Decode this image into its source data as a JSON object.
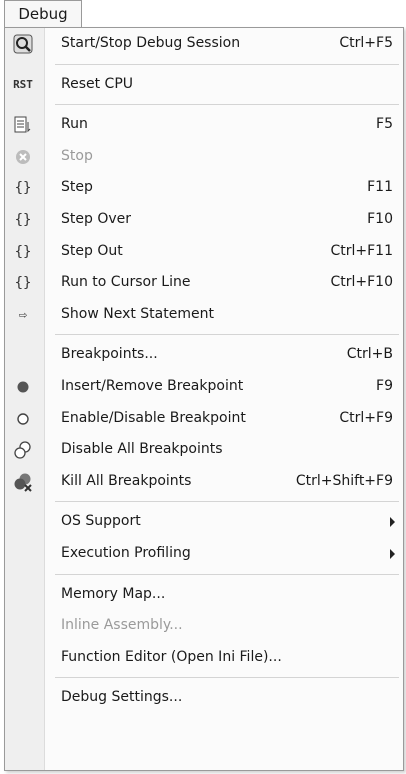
{
  "menu_title": "Debug",
  "items": {
    "start_stop": {
      "label": "Start/Stop Debug Session",
      "shortcut": "Ctrl+F5",
      "icon": "debug-session-icon"
    },
    "reset_cpu": {
      "label": "Reset CPU",
      "shortcut": "",
      "icon": "reset-cpu-icon",
      "icon_text": "RST"
    },
    "run": {
      "label": "Run",
      "shortcut": "F5",
      "icon": "run-icon"
    },
    "stop": {
      "label": "Stop",
      "shortcut": "",
      "icon": "stop-icon",
      "disabled": true
    },
    "step": {
      "label": "Step",
      "shortcut": "F11",
      "icon": "step-icon",
      "icon_text": "{}"
    },
    "step_over": {
      "label": "Step Over",
      "shortcut": "F10",
      "icon": "step-over-icon",
      "icon_text": "{}"
    },
    "step_out": {
      "label": "Step Out",
      "shortcut": "Ctrl+F11",
      "icon": "step-out-icon",
      "icon_text": "{}"
    },
    "run_to_cursor": {
      "label": "Run to Cursor Line",
      "shortcut": "Ctrl+F10",
      "icon": "run-to-cursor-icon",
      "icon_text": "{}"
    },
    "show_next": {
      "label": "Show Next Statement",
      "shortcut": "",
      "icon": "show-next-statement-icon",
      "icon_text": "⇨"
    },
    "breakpoints": {
      "label": "Breakpoints...",
      "shortcut": "Ctrl+B"
    },
    "insert_remove_bp": {
      "label": "Insert/Remove Breakpoint",
      "shortcut": "F9",
      "icon": "breakpoint-filled-icon"
    },
    "enable_disable_bp": {
      "label": "Enable/Disable Breakpoint",
      "shortcut": "Ctrl+F9",
      "icon": "breakpoint-hollow-icon"
    },
    "disable_all_bp": {
      "label": "Disable All Breakpoints",
      "shortcut": "",
      "icon": "disable-all-breakpoints-icon"
    },
    "kill_all_bp": {
      "label": "Kill All Breakpoints",
      "shortcut": "Ctrl+Shift+F9",
      "icon": "kill-all-breakpoints-icon"
    },
    "os_support": {
      "label": "OS Support",
      "submenu": true
    },
    "exec_profiling": {
      "label": "Execution Profiling",
      "submenu": true
    },
    "memory_map": {
      "label": "Memory Map..."
    },
    "inline_assembly": {
      "label": "Inline Assembly...",
      "disabled": true
    },
    "function_editor": {
      "label": "Function Editor (Open Ini File)..."
    },
    "debug_settings": {
      "label": "Debug Settings..."
    }
  }
}
